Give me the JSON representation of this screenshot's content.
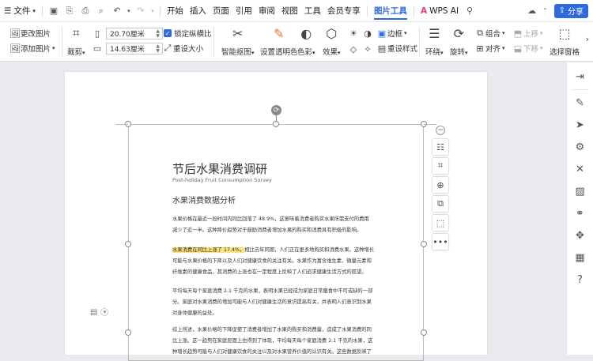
{
  "menubar": {
    "file": "文件",
    "tabs": [
      "开始",
      "插入",
      "页面",
      "引用",
      "审阅",
      "视图",
      "工具",
      "会员专享"
    ],
    "active_tab": "图片工具",
    "wps_ai": "WPS AI",
    "share": "分享"
  },
  "ribbon": {
    "change_image": "更改图片",
    "add_image": "添加图片",
    "crop": "裁剪",
    "width": "20.70厘米",
    "height": "14.63厘米",
    "lock_ratio": "锁定纵横比",
    "reset_size": "重设大小",
    "smart_cutout": "智能抠图",
    "set_transparent": "设置透明色",
    "color": "色彩",
    "effects": "效果",
    "border": "边框",
    "reset_style": "重设样式",
    "wrap": "环绕",
    "rotate": "旋转",
    "group": "组合",
    "align": "对齐",
    "bring_forward": "上移",
    "send_backward": "下移",
    "selection_pane": "选择窗格"
  },
  "document": {
    "title": "节后水果消费调研",
    "subtitle": "Post-holiday Fruit Consumption Survey",
    "section_heading": "水果消费数据分析",
    "para1_l1": "水果价格在最近一段时间内同比回落了 48.9%，这意味着消费者购买水果所需支付的费用",
    "para1_l2": "减少了近一半。这种降价趋势对于鼓励消费者增加水果的购买和消费具有积极的影响。",
    "para2_highlight": "水果消费在同比上涨了 17.4%，",
    "para2_l1_rest": "相比去年同期，人们正在更多地购买和消费水果。这种增长",
    "para2_l2": "可能与水果价格的下降以及人们对健康饮食的关注有关。水果作为富含维生素、微量元素和",
    "para2_l3": "纤维素的健康食品，其消费的上涨也在一定程度上反映了人们追求健康生活方式的愿望。",
    "para3_l1": "平均每天每个家庭消费 2.1 千克的水果，表明水果已经成为家庭日常膳食中不可或缺的一部",
    "para3_l2": "分。家庭对水果消费的增加可能与人们对健康生活的意识提高有关，并表明人们意识到水果",
    "para3_l3": "对身体健康的益处。",
    "para4_l1": "综上所述，水果价格的下降促使了消费者增加了水果的购买和消费量，造成了水果消费的同",
    "para4_l2": "比上涨。这一趋势在家庭层面上也得到了体现，平均每天每个家庭消费 2.1 千克的水果，这",
    "para4_l3": "种增长趋势可能与人们对健康饮食的关注以及对水果营养价值的认识有关。这些数据反映了"
  },
  "colors": {
    "accent": "#2f6bdc",
    "highlight": "#ffe27a"
  }
}
